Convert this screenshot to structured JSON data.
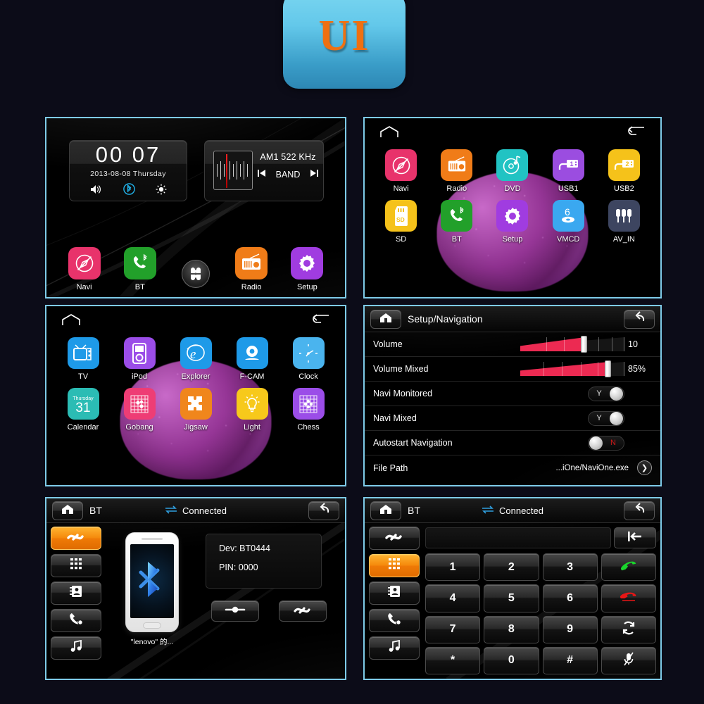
{
  "badge": {
    "label": "UI"
  },
  "home_screen": {
    "clock": {
      "time": "00 07",
      "date": "2013-08-08  Thursday",
      "icons": [
        "volume-icon",
        "bluetooth-icon",
        "brightness-icon"
      ]
    },
    "radio": {
      "frequency": "AM1 522 KHz",
      "band_label": "BAND",
      "prev": "prev-icon",
      "next": "next-icon"
    },
    "dock": [
      {
        "label": "Navi",
        "color": "#e8336b",
        "icon": "navi-compass-icon"
      },
      {
        "label": "BT",
        "color": "#22a02a",
        "icon": "phone-bluetooth-icon"
      },
      {
        "label": "",
        "color": "",
        "icon": "all-apps-icon"
      },
      {
        "label": "Radio",
        "color": "#f07c18",
        "icon": "radio-icon"
      },
      {
        "label": "Setup",
        "color": "#a03ce0",
        "icon": "gear-icon"
      }
    ]
  },
  "apps_page_1": {
    "home_icon": "home-outline-icon",
    "back_icon": "back-arrow-icon",
    "apps": [
      {
        "label": "Navi",
        "color": "#e8336b",
        "icon": "navi-compass-icon"
      },
      {
        "label": "Radio",
        "color": "#f07c18",
        "icon": "radio-icon"
      },
      {
        "label": "DVD",
        "color": "#21c3c3",
        "icon": "dvd-disc-icon"
      },
      {
        "label": "USB1",
        "color": "#9b4de0",
        "icon": "usb1-icon"
      },
      {
        "label": "USB2",
        "color": "#f5c21a",
        "icon": "usb2-icon"
      },
      {
        "label": "SD",
        "color": "#f5c21a",
        "icon": "sd-card-icon"
      },
      {
        "label": "BT",
        "color": "#22a02a",
        "icon": "phone-bluetooth-icon"
      },
      {
        "label": "Setup",
        "color": "#a03ce0",
        "icon": "gear-icon"
      },
      {
        "label": "VMCD",
        "color": "#3aa8f0",
        "icon": "vmcd-icon"
      },
      {
        "label": "AV_IN",
        "color": "#3d4560",
        "icon": "av-in-plugs-icon"
      }
    ]
  },
  "apps_page_2": {
    "home_icon": "home-outline-icon",
    "back_icon": "back-arrow-icon",
    "apps": [
      {
        "label": "TV",
        "color": "#1e9ae8",
        "icon": "tv-icon"
      },
      {
        "label": "iPod",
        "color": "#9b4de8",
        "icon": "ipod-icon"
      },
      {
        "label": "Explorer",
        "color": "#1e9ae8",
        "icon": "explorer-e-icon"
      },
      {
        "label": "F-CAM",
        "color": "#1e9ae8",
        "icon": "camera-icon"
      },
      {
        "label": "Clock",
        "color": "#4ab4ee",
        "icon": "clock-face-icon"
      },
      {
        "label": "Calendar",
        "color": "#2bbcb4",
        "icon": "calendar-icon",
        "day_name": "Thursday",
        "day_number": "31"
      },
      {
        "label": "Gobang",
        "color": "#ee3d75",
        "icon": "gobang-board-icon"
      },
      {
        "label": "Jigsaw",
        "color": "#f0861c",
        "icon": "jigsaw-icon"
      },
      {
        "label": "Light",
        "color": "#f7c91b",
        "icon": "lightbulb-icon"
      },
      {
        "label": "Chess",
        "color": "#9b4de8",
        "icon": "chess-board-icon"
      }
    ]
  },
  "setup_navigation": {
    "home_icon": "home-icon",
    "title": "Setup/Navigation",
    "back_icon": "back-arrow-icon",
    "rows": [
      {
        "label": "Volume",
        "type": "slider",
        "value": "10",
        "percent": 62
      },
      {
        "label": "Volume Mixed",
        "type": "slider",
        "value": "85%",
        "percent": 85
      },
      {
        "label": "Navi Monitored",
        "type": "toggle",
        "state": "Y"
      },
      {
        "label": "Navi Mixed",
        "type": "toggle",
        "state": "Y"
      },
      {
        "label": "Autostart Navigation",
        "type": "toggle",
        "state": "N"
      },
      {
        "label": "File Path",
        "type": "path",
        "value": "...iOne/NaviOne.exe",
        "arrow": "chevron-right-icon"
      }
    ]
  },
  "bt_device": {
    "home_icon": "home-icon",
    "title": "BT",
    "status": "Connected",
    "status_icon": "transfer-arrows-icon",
    "back_icon": "back-arrow-icon",
    "rail": [
      {
        "icon": "bt-pair-icon",
        "active": true
      },
      {
        "icon": "dialpad-icon",
        "active": false
      },
      {
        "icon": "contacts-icon",
        "active": false
      },
      {
        "icon": "call-history-icon",
        "active": false
      },
      {
        "icon": "music-note-icon",
        "active": false
      }
    ],
    "phone_icon": "bluetooth-icon",
    "phone_name": "\"lenovo\" 的...",
    "device_line": "Dev: BT0444",
    "pin_line": "PIN: 0000",
    "actions": [
      {
        "icon": "disconnect-icon"
      },
      {
        "icon": "bt-pair-icon"
      }
    ]
  },
  "bt_dialer": {
    "home_icon": "home-icon",
    "title": "BT",
    "status": "Connected",
    "status_icon": "transfer-arrows-icon",
    "back_icon": "back-arrow-icon",
    "rail": [
      {
        "icon": "bt-pair-icon",
        "active": false
      },
      {
        "icon": "dialpad-icon",
        "active": true
      },
      {
        "icon": "contacts-icon",
        "active": false
      },
      {
        "icon": "call-history-icon",
        "active": false
      },
      {
        "icon": "music-note-icon",
        "active": false
      }
    ],
    "number_value": "",
    "backspace_icon": "backspace-icon",
    "keys": [
      {
        "label": "1",
        "type": "digit"
      },
      {
        "label": "2",
        "type": "digit"
      },
      {
        "label": "3",
        "type": "digit"
      },
      {
        "label": "",
        "type": "call",
        "icon": "call-answer-icon"
      },
      {
        "label": "4",
        "type": "digit"
      },
      {
        "label": "5",
        "type": "digit"
      },
      {
        "label": "6",
        "type": "digit"
      },
      {
        "label": "",
        "type": "hangup",
        "icon": "call-end-icon"
      },
      {
        "label": "7",
        "type": "digit"
      },
      {
        "label": "8",
        "type": "digit"
      },
      {
        "label": "9",
        "type": "digit"
      },
      {
        "label": "",
        "type": "switch",
        "icon": "transfer-audio-icon"
      },
      {
        "label": "*",
        "type": "digit"
      },
      {
        "label": "0",
        "type": "digit"
      },
      {
        "label": "#",
        "type": "digit"
      },
      {
        "label": "",
        "type": "mute",
        "icon": "mic-mute-icon"
      }
    ]
  },
  "theme": {
    "page_background": "#0c0c18",
    "panel_border": "#7ecbe8",
    "accent_orange": "#f58a0c",
    "slider_red": "#ec2a52"
  }
}
